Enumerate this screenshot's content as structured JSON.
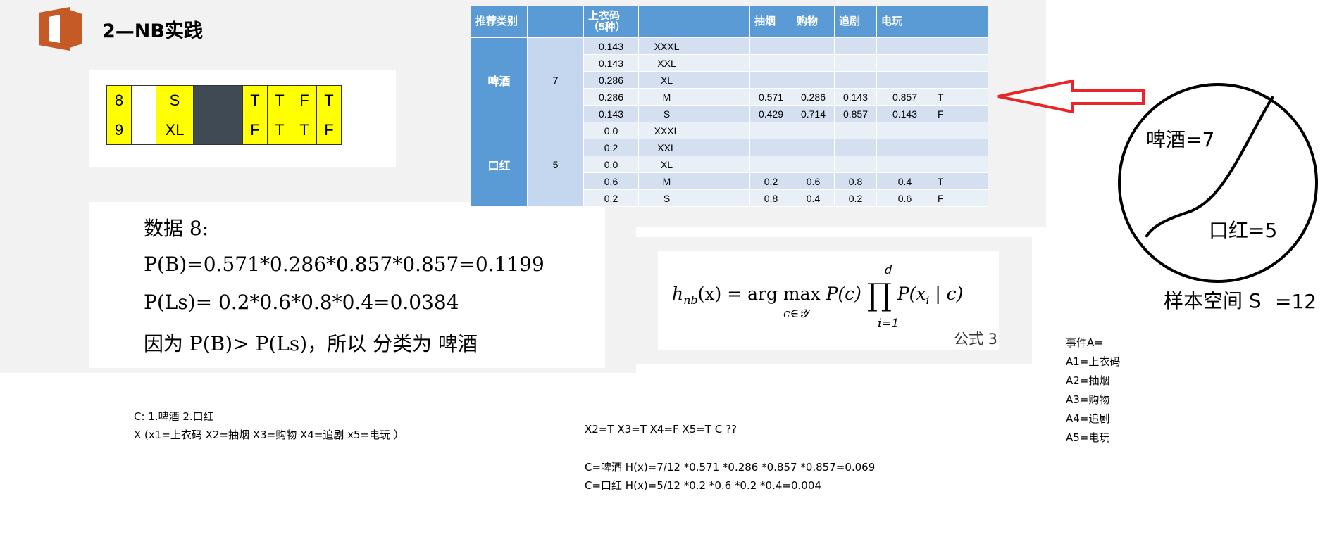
{
  "title": "2—NB实践",
  "mini_table": [
    [
      "8",
      "",
      "S",
      "",
      "",
      "T",
      "T",
      "F",
      "T"
    ],
    [
      "9",
      "",
      "XL",
      "",
      "",
      "F",
      "T",
      "T",
      "F"
    ]
  ],
  "calc": {
    "line1": "数据 8:",
    "line2": "P(B)=0.571*0.286*0.857*0.857=0.1199",
    "line3": "P(Ls)= 0.2*0.6*0.8*0.4=0.0384",
    "line4": "因为 P(B)> P(Ls)，所以 分类为 啤酒"
  },
  "table": {
    "headers": [
      "推荐类别",
      "上衣码（5种）",
      "",
      "",
      "抽烟",
      "购物",
      "追剧",
      "电玩",
      ""
    ],
    "groups": [
      {
        "category": "啤酒",
        "count": "7",
        "rows": [
          [
            "0.143",
            "XXXL",
            "",
            "",
            "",
            "",
            "",
            ""
          ],
          [
            "0.143",
            "XXL",
            "",
            "",
            "",
            "",
            "",
            ""
          ],
          [
            "0.286",
            "XL",
            "",
            "",
            "",
            "",
            "",
            ""
          ],
          [
            "0.286",
            "M",
            "",
            "0.571",
            "0.286",
            "0.143",
            "0.857",
            "T"
          ],
          [
            "0.143",
            "S",
            "",
            "0.429",
            "0.714",
            "0.857",
            "0.143",
            "F"
          ]
        ]
      },
      {
        "category": "口红",
        "count": "5",
        "rows": [
          [
            "0.0",
            "XXXL",
            "",
            "",
            "",
            "",
            "",
            ""
          ],
          [
            "0.2",
            "XXL",
            "",
            "",
            "",
            "",
            "",
            ""
          ],
          [
            "0.0",
            "XL",
            "",
            "",
            "",
            "",
            "",
            ""
          ],
          [
            "0.6",
            "M",
            "",
            "0.2",
            "0.6",
            "0.8",
            "0.4",
            "T"
          ],
          [
            "0.2",
            "S",
            "",
            "0.8",
            "0.4",
            "0.2",
            "0.6",
            "F"
          ]
        ]
      }
    ]
  },
  "formula": {
    "lhs": "h",
    "lhs_sub": "nb",
    "expr1": "(x) = arg max",
    "expr2": "P(c)",
    "expr3": "P(x",
    "expr4": "| c)",
    "under_max": "c∈𝒴",
    "sub_i": "i",
    "prod_top": "d",
    "prod_bottom": "i=1",
    "tag": "公式 3"
  },
  "circle": {
    "beer": "啤酒=7",
    "lipstick": "口红=5",
    "sample_space": "样本空间 S",
    "sample_count": "=12"
  },
  "events": {
    "header": "事件A=",
    "items": [
      "A1=上衣码",
      "A2=抽烟",
      "A3=购物",
      "A4=追剧",
      "A5=电玩"
    ]
  },
  "notes_left": {
    "line1": "C:   1.啤酒 2.口红",
    "line2": "X  (x1=上衣码  X2=抽烟 X3=购物  X4=追剧 x5=电玩 ）"
  },
  "notes_mid": {
    "line1": "X2=T  X3=T  X4=F    X5=T     C ??",
    "line2": "C=啤酒  H(x)=7/12  *0.571  *0.286  *0.857  *0.857=0.069",
    "line3": "C=口红  H(x)=5/12  *0.2 *0.6 *0.2 *0.4=0.004"
  },
  "colors": {
    "header_blue": "#5b9bd5",
    "row_light": "#e9eff7",
    "row_mid": "#d4e0f0",
    "logo_orange": "#c55a27",
    "arrow_red": "#e8262a",
    "cell_yellow": "#ffff00"
  }
}
